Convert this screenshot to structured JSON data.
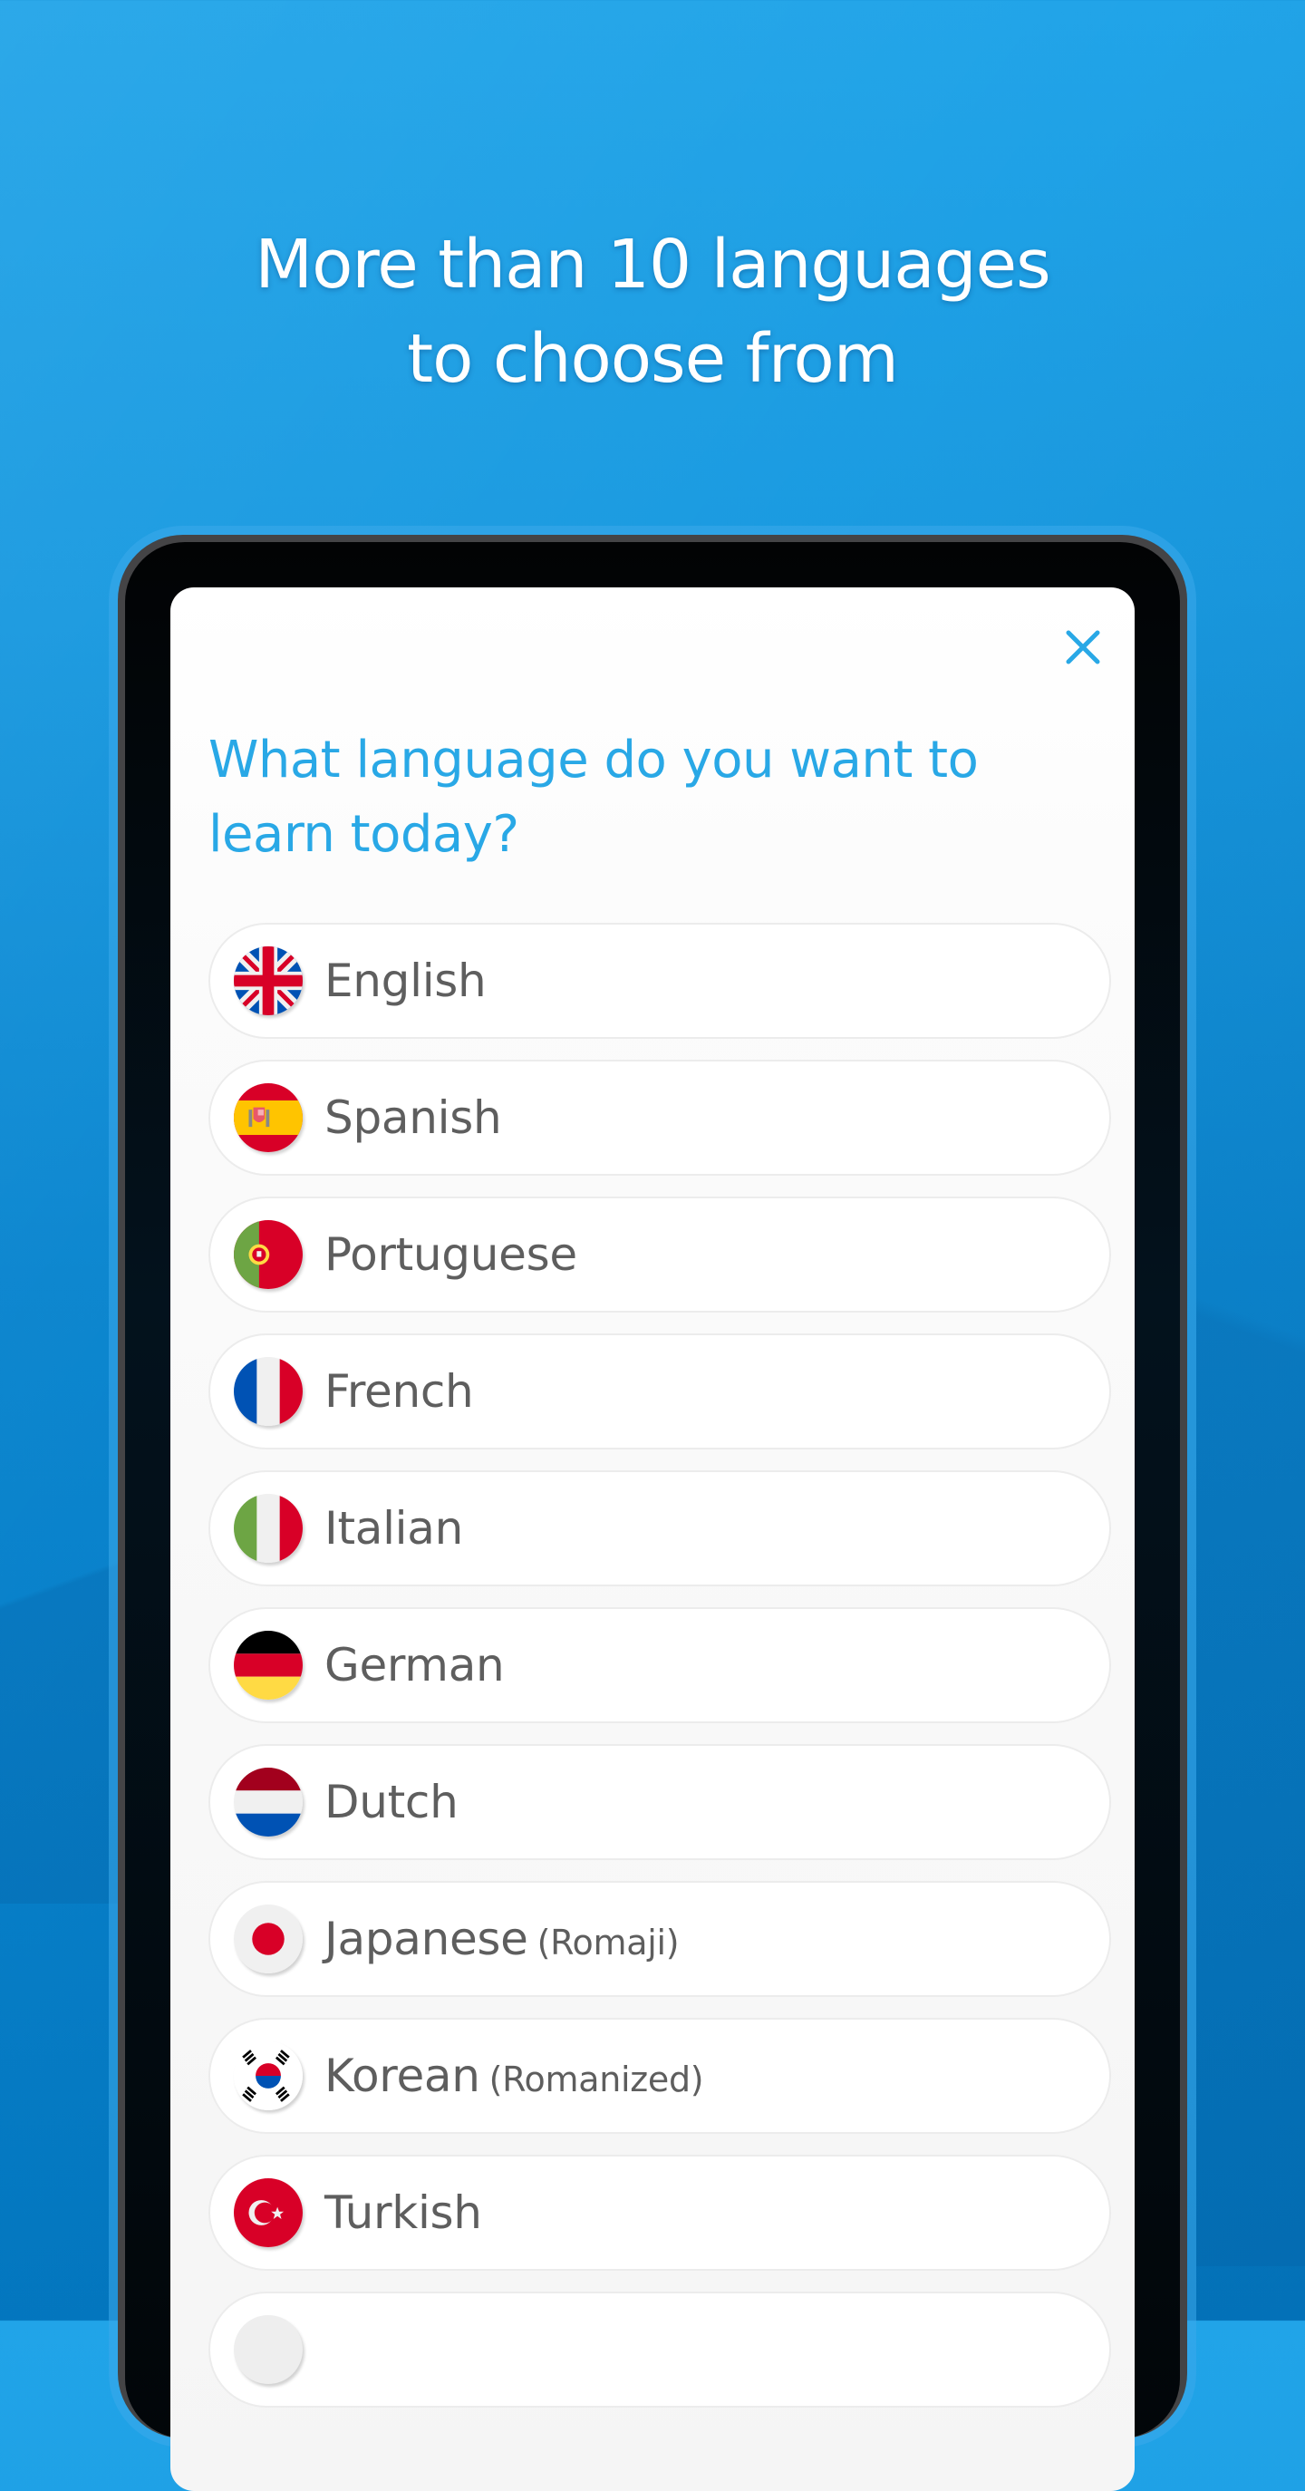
{
  "promo": {
    "headline_line1": "More than 10 languages",
    "headline_line2": "to choose from"
  },
  "colors": {
    "accent": "#29a8e6",
    "background_top": "#21a4e8",
    "background_bottom": "#0379c2",
    "label_text": "#5e5e5e"
  },
  "dialog": {
    "close_icon": "close-icon",
    "question": "What language do you want to learn today?",
    "languages": [
      {
        "label": "English",
        "sub": "",
        "flag": "uk-flag-icon"
      },
      {
        "label": "Spanish",
        "sub": "",
        "flag": "spain-flag-icon"
      },
      {
        "label": "Portuguese",
        "sub": "",
        "flag": "portugal-flag-icon"
      },
      {
        "label": "French",
        "sub": "",
        "flag": "france-flag-icon"
      },
      {
        "label": "Italian",
        "sub": "",
        "flag": "italy-flag-icon"
      },
      {
        "label": "German",
        "sub": "",
        "flag": "germany-flag-icon"
      },
      {
        "label": "Dutch",
        "sub": "",
        "flag": "netherlands-flag-icon"
      },
      {
        "label": "Japanese",
        "sub": "(Romaji)",
        "flag": "japan-flag-icon"
      },
      {
        "label": "Korean",
        "sub": "(Romanized)",
        "flag": "korea-flag-icon"
      },
      {
        "label": "Turkish",
        "sub": "",
        "flag": "turkey-flag-icon"
      },
      {
        "label": "",
        "sub": "",
        "flag": ""
      }
    ]
  }
}
